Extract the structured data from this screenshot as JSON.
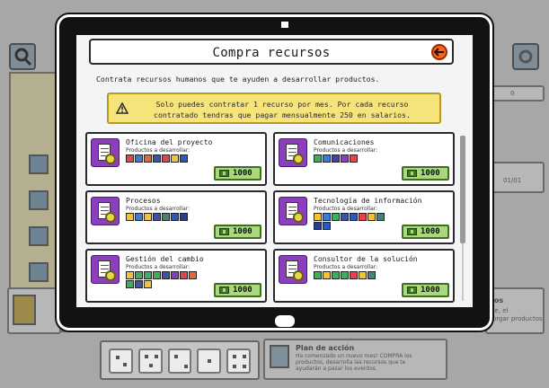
{
  "modal": {
    "title": "Compra recursos",
    "intro": "Contrata recursos humanos que te ayuden a desarrollar productos.",
    "warning": "Solo puedes contratar 1 recurso por mes. Por cada recurso contratado tendras que pagar mensualmente 250 en salarios.",
    "products_label": "Productos a desarrollar:"
  },
  "resources": [
    {
      "name": "Oficina del proyecto",
      "price": "1000",
      "products": [
        "#e5454a",
        "#3b7dd8",
        "#e66a2f",
        "#3e53a6",
        "#e5454a",
        "#f2c33a",
        "#2c58b8"
      ]
    },
    {
      "name": "Comunicaciones",
      "price": "1000",
      "products": [
        "#3fae5a",
        "#3b7dd8",
        "#4a3fa6",
        "#8a3fbf",
        "#e5454a"
      ]
    },
    {
      "name": "Procesos",
      "price": "1000",
      "products": [
        "#f2c33a",
        "#3b7dd8",
        "#f2c33a",
        "#3e53a6",
        "#4a7f7a",
        "#2c58b8",
        "#2c3e8a"
      ]
    },
    {
      "name": "Tecnología de información",
      "price": "1000",
      "products": [
        "#f2c33a",
        "#3b7dd8",
        "#3fae5a",
        "#3e53a6",
        "#2c58b8",
        "#e5454a",
        "#f2c33a",
        "#4a7f7a",
        "#2c3e8a",
        "#2c58b8"
      ]
    },
    {
      "name": "Gestión del cambio",
      "price": "1000",
      "products": [
        "#f2c33a",
        "#3fae5a",
        "#3fae5a",
        "#3fae5a",
        "#3e53a6",
        "#8a3fbf",
        "#e5454a",
        "#e66a2f",
        "#3fae5a",
        "#3e53a6",
        "#f2c33a"
      ]
    },
    {
      "name": "Consultor de la solución",
      "price": "1000",
      "products": [
        "#3fae5a",
        "#f2c33a",
        "#3fae5a",
        "#3fae5a",
        "#e5454a",
        "#f2c33a",
        "#4a7f7a"
      ]
    }
  ],
  "background": {
    "counter_top": "0",
    "counter_mid": "01/01",
    "right_panel_title": "tos",
    "right_panel_text": "ue, el\nlorgar productos.",
    "plan": {
      "title": "Plan de acción",
      "text": "Ha comenzado un nuevo mes! COMPRA los productos, desarrolla las recursos que te ayudarán a pasar los eventos."
    }
  },
  "colors": {
    "accent": "#f26522",
    "warning_bg": "#f6e37a",
    "price_bg": "#a9d97c",
    "card_icon": "#8b3fbf"
  }
}
